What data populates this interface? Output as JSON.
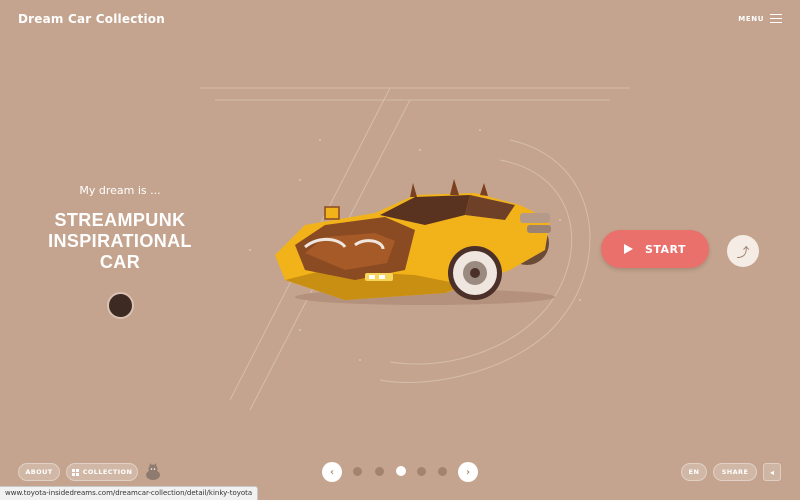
{
  "header": {
    "title": "Dream Car Collection",
    "menu_label": "MENU"
  },
  "hero": {
    "intro": "My dream is ...",
    "title": "STREAMPUNK INSPIRATIONAL CAR",
    "start_label": "START"
  },
  "footer": {
    "about_label": "ABOUT",
    "collection_label": "COLLECTION",
    "lang_label": "EN",
    "share_label": "SHARE",
    "prev_icon": "chevron-left-icon",
    "next_icon": "chevron-right-icon",
    "pagination": {
      "count": 5,
      "active_index": 2
    }
  },
  "statusbar": {
    "url": "www.toyota-insidedreams.com/dreamcar-collection/detail/kinky-toyota"
  },
  "colors": {
    "background": "#c4a48e",
    "start_button": "#e9706b",
    "car_body": "#f2b31a"
  }
}
